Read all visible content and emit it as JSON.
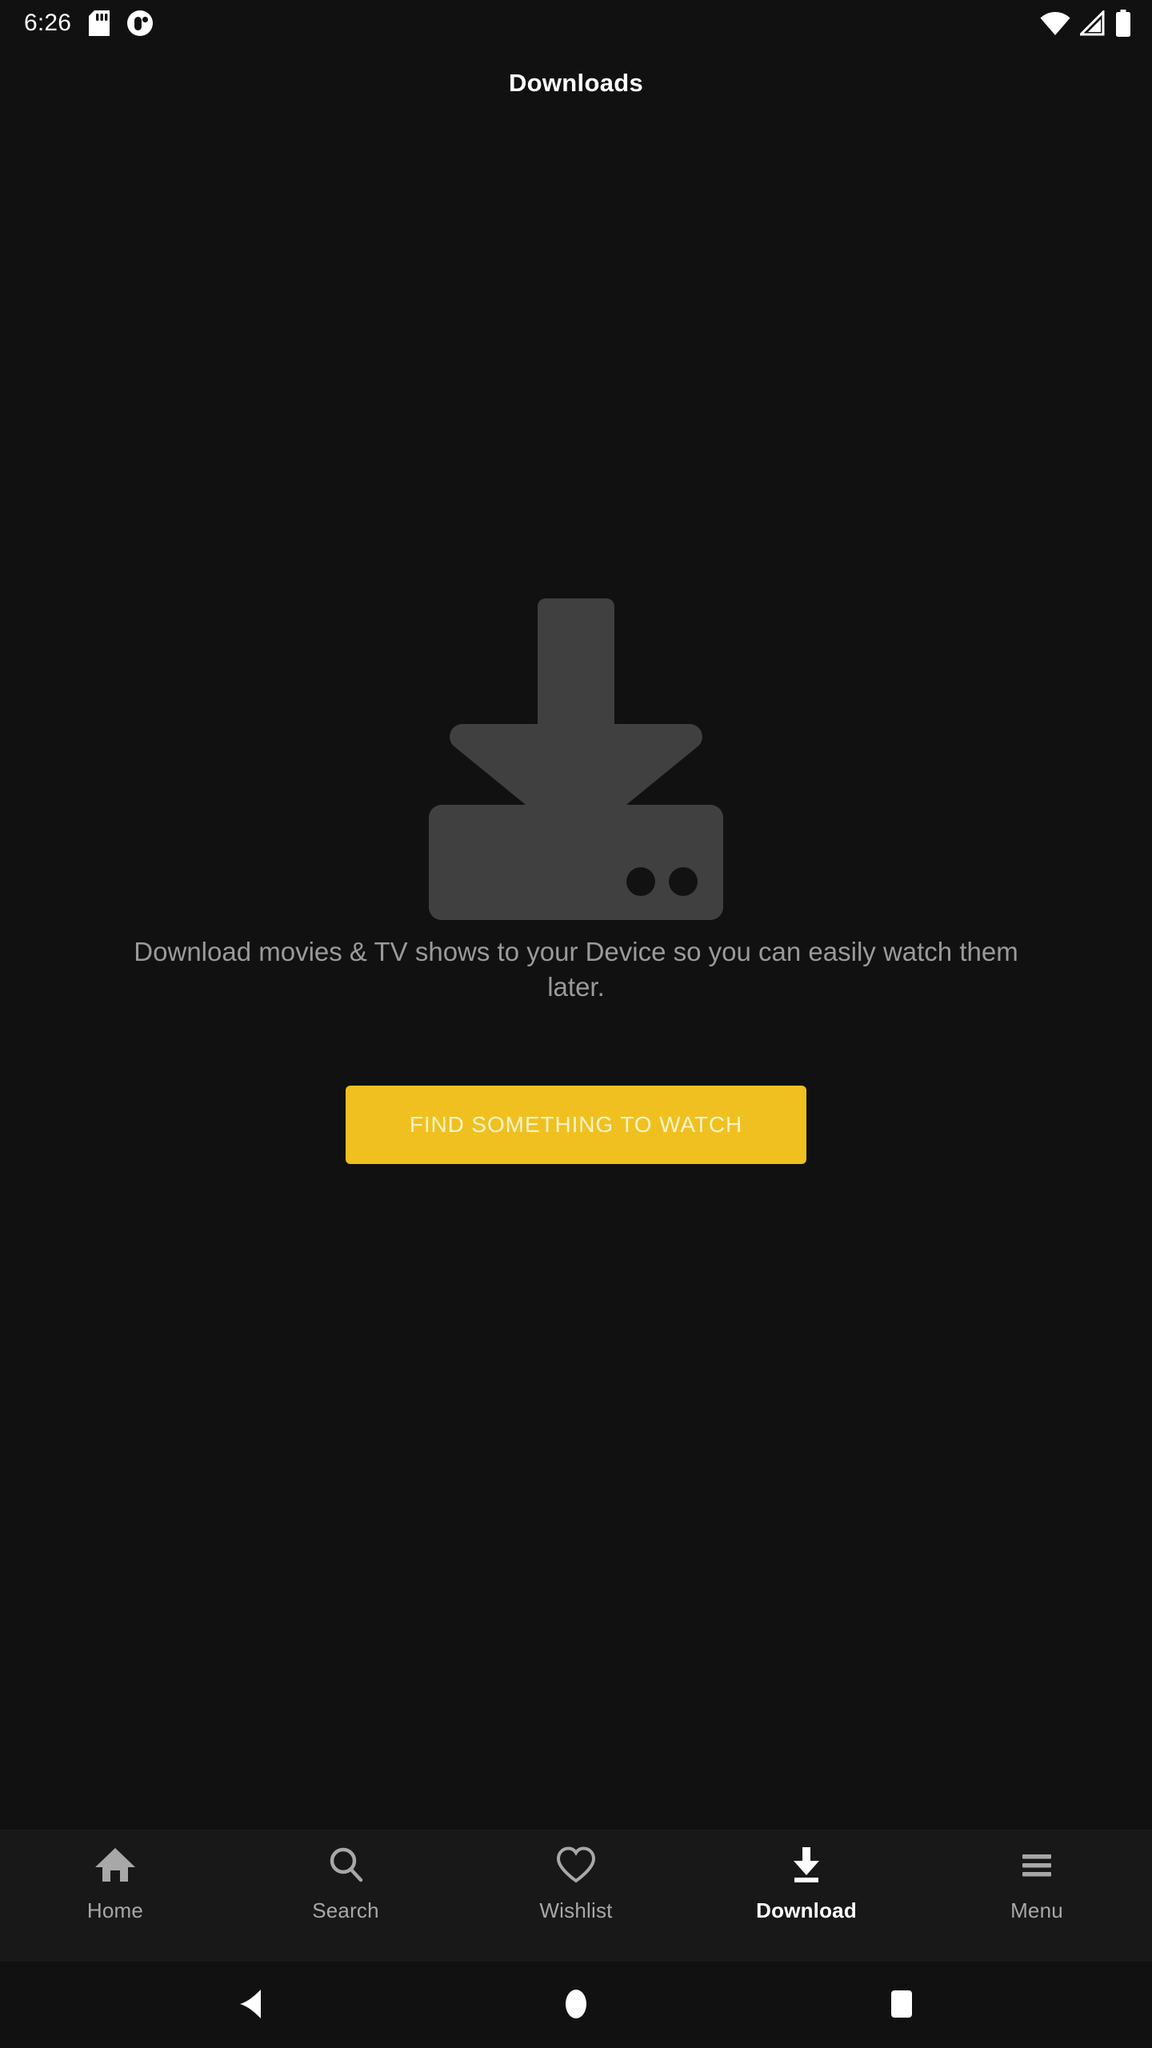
{
  "status_bar": {
    "time": "6:26",
    "left_icons": [
      "sd-card-icon",
      "app-notification-icon"
    ],
    "right_icons": [
      "wifi-icon",
      "cellular-signal-icon",
      "battery-icon"
    ]
  },
  "header": {
    "title": "Downloads"
  },
  "empty_state": {
    "illustration": "download-to-tray-icon",
    "message": "Download movies & TV shows to your Device so you can easily watch them later.",
    "cta_label": "FIND SOMETHING TO WATCH",
    "cta_color": "#efc01f",
    "cta_text_color": "#fdf3cd",
    "illustration_color": "#404040",
    "message_color": "#9a9a9a"
  },
  "tab_bar": {
    "active_index": 3,
    "items": [
      {
        "label": "Home",
        "icon": "home-icon"
      },
      {
        "label": "Search",
        "icon": "search-icon"
      },
      {
        "label": "Wishlist",
        "icon": "heart-icon"
      },
      {
        "label": "Download",
        "icon": "download-icon"
      },
      {
        "label": "Menu",
        "icon": "hamburger-menu-icon"
      }
    ]
  },
  "system_nav": {
    "buttons": [
      {
        "name": "back",
        "icon": "triangle-back-icon"
      },
      {
        "name": "home",
        "icon": "circle-home-icon"
      },
      {
        "name": "recents",
        "icon": "square-recents-icon"
      }
    ]
  }
}
